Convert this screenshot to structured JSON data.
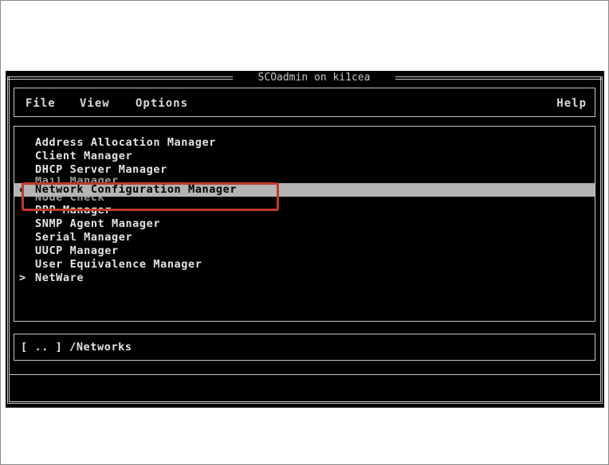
{
  "window": {
    "title": "SCOadmin on ki1cea"
  },
  "menubar": {
    "file": "File",
    "view": "View",
    "options": "Options",
    "help": "Help"
  },
  "list": {
    "items": [
      {
        "marker": "",
        "label": "Address Allocation Manager"
      },
      {
        "marker": "",
        "label": "Client Manager"
      },
      {
        "marker": "",
        "label": "DHCP Server Manager"
      },
      {
        "marker": "",
        "label": "Mail Manager"
      },
      {
        "marker": "▸",
        "label": "Network Configuration Manager",
        "selected": true
      },
      {
        "marker": "",
        "label": "Node Check"
      },
      {
        "marker": "",
        "label": "PPP Manager"
      },
      {
        "marker": "",
        "label": "SNMP Agent Manager"
      },
      {
        "marker": "",
        "label": "Serial Manager"
      },
      {
        "marker": "",
        "label": "UUCP Manager"
      },
      {
        "marker": "",
        "label": "User Equivalence Manager"
      },
      {
        "marker": ">",
        "label": "NetWare"
      }
    ]
  },
  "path": {
    "text": "[ .. ] /Networks"
  },
  "colors": {
    "highlight": "#c0392b",
    "selection": "#b4b4b4",
    "terminal_bg": "#000000"
  }
}
